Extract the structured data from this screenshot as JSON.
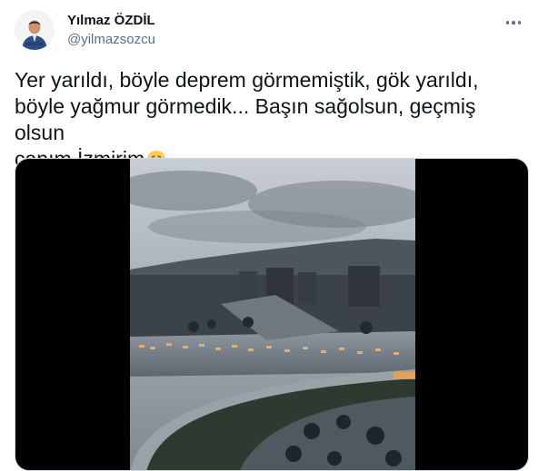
{
  "author": {
    "display_name": "Yılmaz ÖZDİL",
    "handle": "@yilmazsozcu"
  },
  "tweet": {
    "text": "Yer yarıldı, böyle deprem görmemiştik, gök yarıldı,\nböyle yağmur görmedik... Başın sağolsun, geçmiş olsun\ncanım İzmirim",
    "emoji": "crying-face-emoji"
  },
  "media": {
    "type": "video",
    "content": "flooded-city-aerial-view"
  },
  "icons": {
    "more": "more-options-icon"
  },
  "colors": {
    "text_primary": "#0f1419",
    "text_secondary": "#5b7083",
    "media_border": "#cfd9de",
    "video_background": "#000000"
  }
}
